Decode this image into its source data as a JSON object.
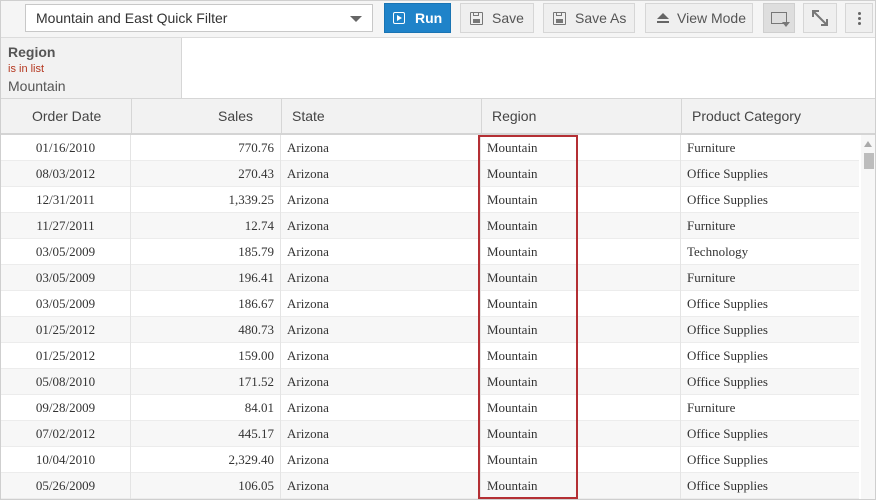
{
  "toolbar": {
    "filter_select_value": "Mountain and East Quick Filter",
    "run_label": "Run",
    "save_label": "Save",
    "save_as_label": "Save As",
    "view_mode_label": "View Mode",
    "run_color": "#1f83c9"
  },
  "filter": {
    "field": "Region",
    "operator": "is in list",
    "value": "Mountain",
    "operator_color": "#b5371f"
  },
  "table": {
    "columns": [
      "Order Date",
      "Sales",
      "State",
      "Region",
      "Product Category"
    ],
    "highlight_column": "Region",
    "highlight_color": "#b42f34",
    "rows": [
      [
        "01/16/2010",
        "770.76",
        "Arizona",
        "Mountain",
        "Furniture"
      ],
      [
        "08/03/2012",
        "270.43",
        "Arizona",
        "Mountain",
        "Office Supplies"
      ],
      [
        "12/31/2011",
        "1,339.25",
        "Arizona",
        "Mountain",
        "Office Supplies"
      ],
      [
        "11/27/2011",
        "12.74",
        "Arizona",
        "Mountain",
        "Furniture"
      ],
      [
        "03/05/2009",
        "185.79",
        "Arizona",
        "Mountain",
        "Technology"
      ],
      [
        "03/05/2009",
        "196.41",
        "Arizona",
        "Mountain",
        "Furniture"
      ],
      [
        "03/05/2009",
        "186.67",
        "Arizona",
        "Mountain",
        "Office Supplies"
      ],
      [
        "01/25/2012",
        "480.73",
        "Arizona",
        "Mountain",
        "Office Supplies"
      ],
      [
        "01/25/2012",
        "159.00",
        "Arizona",
        "Mountain",
        "Office Supplies"
      ],
      [
        "05/08/2010",
        "171.52",
        "Arizona",
        "Mountain",
        "Office Supplies"
      ],
      [
        "09/28/2009",
        "84.01",
        "Arizona",
        "Mountain",
        "Furniture"
      ],
      [
        "07/02/2012",
        "445.17",
        "Arizona",
        "Mountain",
        "Office Supplies"
      ],
      [
        "10/04/2010",
        "2,329.40",
        "Arizona",
        "Mountain",
        "Office Supplies"
      ],
      [
        "05/26/2009",
        "106.05",
        "Arizona",
        "Mountain",
        "Office Supplies"
      ]
    ]
  }
}
